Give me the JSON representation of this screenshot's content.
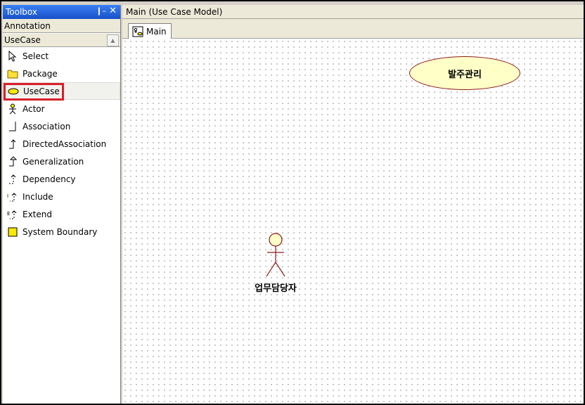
{
  "toolbox": {
    "title": "Toolbox",
    "pin_icon": "pin-icon",
    "close_icon": "close-icon",
    "sections": [
      "Annotation",
      "UseCase"
    ],
    "items": [
      {
        "label": "Select",
        "icon": "pointer-icon"
      },
      {
        "label": "Package",
        "icon": "package-icon"
      },
      {
        "label": "UseCase",
        "icon": "usecase-icon"
      },
      {
        "label": "Actor",
        "icon": "actor-icon"
      },
      {
        "label": "Association",
        "icon": "association-icon"
      },
      {
        "label": "DirectedAssociation",
        "icon": "directed-association-icon"
      },
      {
        "label": "Generalization",
        "icon": "generalization-icon"
      },
      {
        "label": "Dependency",
        "icon": "dependency-icon"
      },
      {
        "label": "Include",
        "icon": "include-icon"
      },
      {
        "label": "Extend",
        "icon": "extend-icon"
      },
      {
        "label": "System Boundary",
        "icon": "system-boundary-icon"
      }
    ],
    "selected_item": "UseCase",
    "highlight_color": "#d8202a"
  },
  "main": {
    "title": "Main (Use Case Model)",
    "tabs": [
      {
        "label": "Main",
        "icon": "diagram-icon"
      }
    ]
  },
  "diagram": {
    "usecases": [
      {
        "label": "발주관리"
      }
    ],
    "actors": [
      {
        "label": "업무담당자"
      }
    ],
    "usecase_fill": "#ffffc8",
    "element_stroke": "#8b1a1a"
  }
}
